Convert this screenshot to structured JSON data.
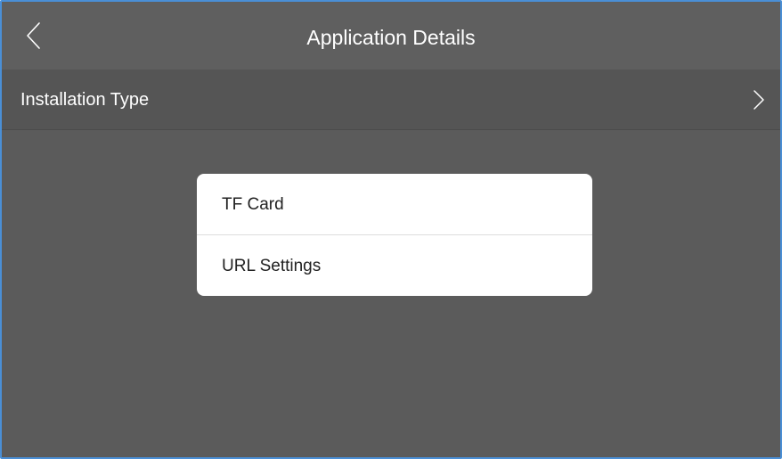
{
  "header": {
    "title": "Application Details",
    "back_icon": "chevron-left-icon"
  },
  "settings": {
    "installation_type_label": "Installation Type",
    "chevron_icon": "chevron-right-icon"
  },
  "dialog": {
    "options": [
      {
        "label": "TF Card"
      },
      {
        "label": "URL Settings"
      }
    ]
  },
  "colors": {
    "frame_border": "#4a8fd6",
    "title_bar": "#5f5f5f",
    "row_background": "#555555",
    "content_background": "#5b5b5b",
    "dialog_background": "#ffffff",
    "dialog_text": "#222222"
  }
}
